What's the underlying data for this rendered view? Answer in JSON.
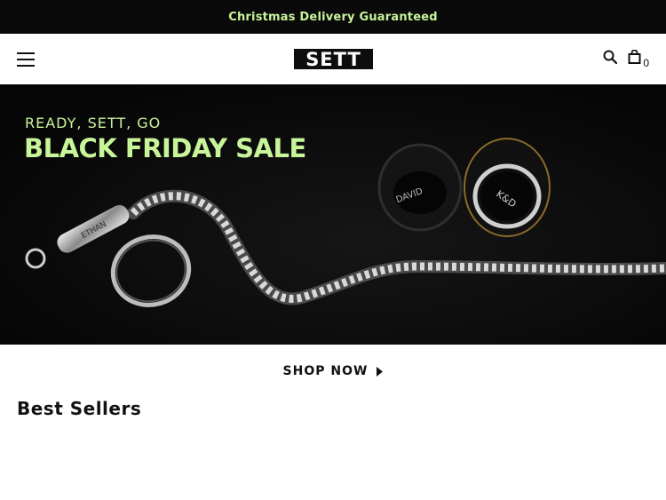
{
  "announcement": {
    "text": "Christmas Delivery Guaranteed"
  },
  "header": {
    "logo_text": "SETT",
    "menu_icon": "hamburger-menu-icon",
    "search_icon": "search-icon",
    "cart_icon": "shopping-bag-icon",
    "cart_count": "0"
  },
  "hero": {
    "tagline": "READY, SETT, GO",
    "title": "BLACK FRIDAY SALE",
    "tag_text": "ETHAN",
    "ring_text_1": "DAVID",
    "ring_text_2": "K&D",
    "accent_color": "#c8f49a"
  },
  "cta": {
    "label": "SHOP NOW"
  },
  "section": {
    "title": "Best Sellers"
  }
}
